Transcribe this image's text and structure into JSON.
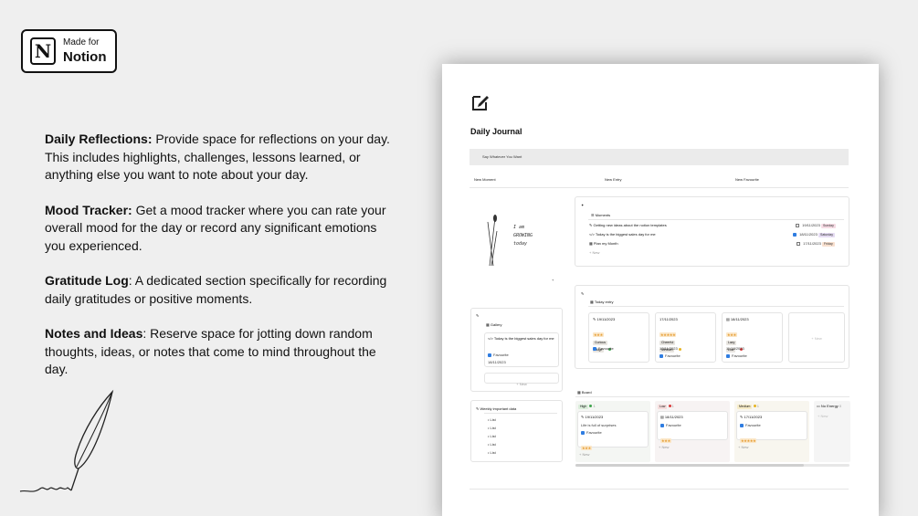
{
  "badge": {
    "line1": "Made for",
    "line2": "Notion",
    "logo_letter": "N"
  },
  "features": [
    {
      "title": "Daily Reflections:",
      "text": " Provide space for reflections on your day. This includes highlights, challenges, lessons learned, or anything else you want to note about your day."
    },
    {
      "title": "Mood Tracker:",
      "text": " Get a mood tracker where you can rate your overall mood for the day or record any significant emotions you experienced."
    },
    {
      "title": "Gratitude Log",
      "text": ": A dedicated section specifically for recording daily gratitudes or positive moments."
    },
    {
      "title": "Notes and Ideas",
      "text": ": Reserve space for jotting down random thoughts, ideas, or notes that come to mind throughout the day."
    }
  ],
  "page": {
    "title": "Daily Journal",
    "say_bar": "Say Whatever You Want",
    "buttons": [
      "New Moment",
      "New Entry",
      "New Favourite"
    ],
    "drawing_text": [
      "I am",
      "GROWING",
      "today"
    ],
    "moments": {
      "label": "Moments",
      "rows": [
        {
          "text": "Getting new ideas about the notion templates",
          "date": "19/11/2023",
          "day": "Sunday",
          "day_color": "#f6dbe4",
          "checked": false
        },
        {
          "text": "Today is the biggest sales day for me",
          "date": "18/11/2023",
          "day": "Saturday",
          "day_color": "#e6dcf3",
          "checked": true
        },
        {
          "text": "Plan my Month",
          "date": "17/11/2023",
          "day": "Friday",
          "day_color": "#f8e0cf",
          "checked": false
        }
      ],
      "new": "+ New"
    },
    "gallery": {
      "label": "Gallery",
      "card_text": "Today is the biggest sales day for me",
      "card_check": "Favourite",
      "card_date": "18/11/2023",
      "new": "+ New"
    },
    "today_entry": {
      "label": "Today entry",
      "cards": [
        {
          "date": "19/11/2023",
          "stars": "★★★",
          "tags": [
            "Curious",
            "Huge"
          ],
          "check": "Favourite"
        },
        {
          "date": "17/11/2023",
          "stars": "★★★★★",
          "tags": [
            "Cheerful",
            "Medium"
          ],
          "sub_date": "17/11/2023",
          "check": "Favourite"
        },
        {
          "date": "18/11/2023",
          "stars": "★★★",
          "tags": [
            "Lazy",
            "Low"
          ],
          "sub_date": "11/18/2023",
          "check": "Favourite"
        }
      ],
      "new": "+ New"
    },
    "weekly": {
      "label": "Weekly important data",
      "items": [
        "List",
        "List",
        "List",
        "List",
        "List"
      ]
    },
    "board": {
      "label": "Board",
      "columns": [
        {
          "name": "High",
          "dot": "#3fa34d",
          "count": "1",
          "date": "19/11/2023",
          "line": "Life is full of surprises",
          "check": "Favourite",
          "stars": "★★★",
          "new": "+ New"
        },
        {
          "name": "Low",
          "dot": "#d93a3a",
          "count": "1",
          "date": "18/11/2023",
          "line": "",
          "check": "Favourite",
          "stars": "★★★",
          "new": "+ New"
        },
        {
          "name": "Medium",
          "dot": "#e6b422",
          "count": "1",
          "date": "17/11/2023",
          "line": "",
          "check": "Favourite",
          "stars": "★★★★★",
          "new": "+ New"
        },
        {
          "name": "No Energy",
          "dot": "",
          "count": "0",
          "date": "",
          "line": "",
          "check": "",
          "stars": "",
          "new": "+ New"
        }
      ]
    }
  },
  "colors": {
    "background": "#efefef",
    "check_blue": "#2f7de1",
    "star": "#e4992b"
  }
}
